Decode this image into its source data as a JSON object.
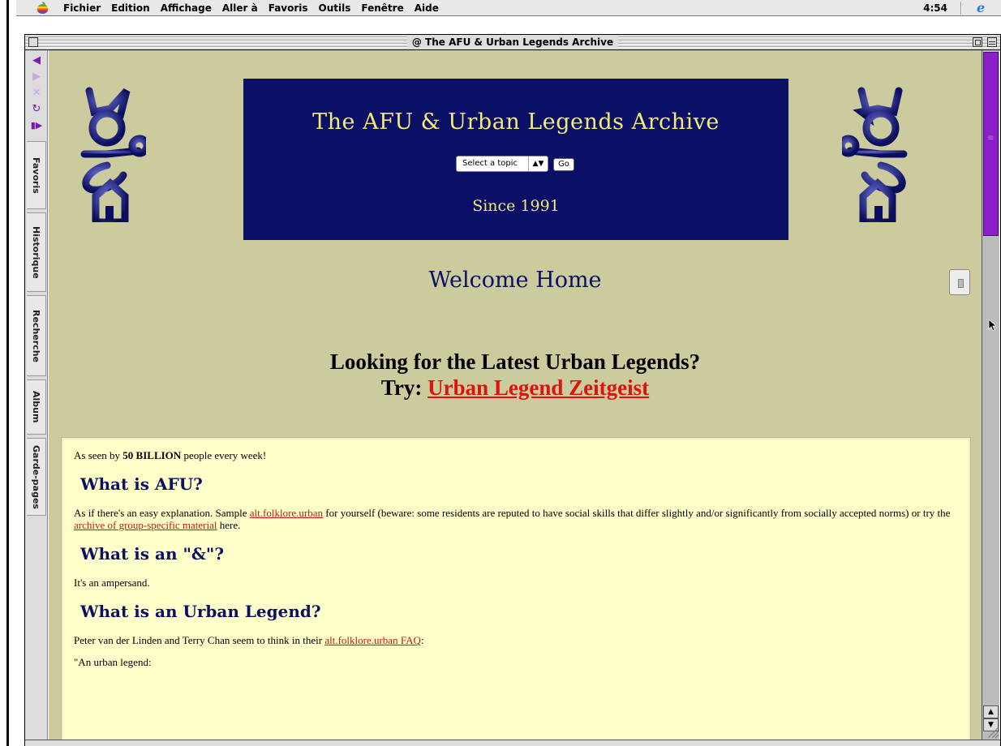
{
  "menubar": {
    "items": [
      "Fichier",
      "Edition",
      "Affichage",
      "Aller à",
      "Favoris",
      "Outils",
      "Fenêtre",
      "Aide"
    ],
    "clock": "4:54"
  },
  "window": {
    "title": "@ The AFU & Urban Legends Archive"
  },
  "explorer": {
    "tabs": [
      "Favoris",
      "Historique",
      "Recherche",
      "Album",
      "Garde-pages"
    ]
  },
  "page": {
    "banner_title": "The AFU & Urban Legends Archive",
    "topic_select": "Select a topic",
    "go_label": "Go",
    "since": "Since 1991",
    "welcome": "Welcome Home",
    "latest_line1": "Looking for the Latest Urban Legends?",
    "latest_try": "Try: ",
    "latest_link": "Urban Legend Zeitgeist"
  },
  "infobox": {
    "seen_pre": "As seen by ",
    "seen_bold": "50 BILLION",
    "seen_post": " people every week!",
    "h_afu": "What is AFU?",
    "afu_pre": "As if there's an easy explanation. Sample ",
    "afu_link1": "alt.folklore.urban",
    "afu_mid": " for yourself (beware: some residents are reputed to have social skills that differ slightly and/or significantly from socially accepted norms) or try the ",
    "afu_link2": "archive of group-specific material",
    "afu_post": " here.",
    "h_amp": "What is an \"&\"?",
    "amp_text": "It's an ampersand.",
    "h_ul": "What is an Urban Legend?",
    "ul_pre": "Peter van der Linden and Terry Chan seem to think in their ",
    "ul_link": "alt.folklore.urban FAQ",
    "ul_post": ":",
    "quote": "\"An urban legend:"
  },
  "colors": {
    "page_bg": "#cccb9d",
    "banner_bg": "#0c0f66",
    "banner_text": "#f4eb77",
    "link_red": "#e0120d",
    "infobox_bg": "#ffffc9",
    "scroll_thumb": "#8c1fc7"
  }
}
